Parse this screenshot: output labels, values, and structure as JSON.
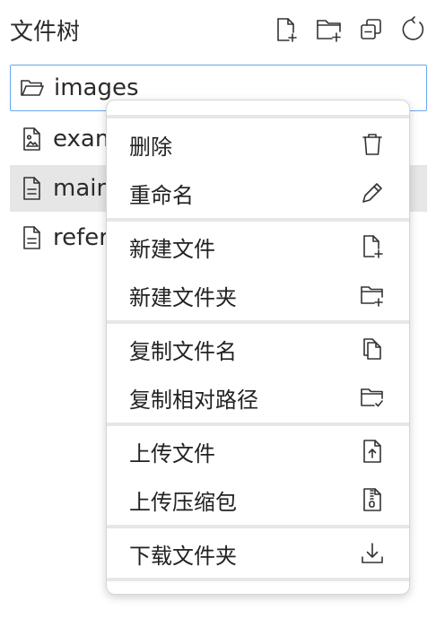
{
  "header": {
    "title": "文件树",
    "buttons": [
      {
        "icon": "new-file-icon"
      },
      {
        "icon": "new-folder-icon"
      },
      {
        "icon": "collapse-all-icon"
      },
      {
        "icon": "refresh-icon"
      }
    ]
  },
  "tree": {
    "items": [
      {
        "label": "images",
        "icon": "folder-open-icon",
        "state": "selected"
      },
      {
        "label": "exam",
        "icon": "image-file-icon",
        "state": "normal"
      },
      {
        "label": "main",
        "icon": "text-file-icon",
        "state": "active"
      },
      {
        "label": "refer",
        "icon": "text-file-icon",
        "state": "normal"
      }
    ]
  },
  "context_menu": {
    "items": [
      {
        "label": "删除",
        "icon": "trash-icon"
      },
      {
        "label": "重命名",
        "icon": "pencil-icon"
      },
      {
        "label": "新建文件",
        "icon": "new-file-icon"
      },
      {
        "label": "新建文件夹",
        "icon": "new-folder-icon"
      },
      {
        "label": "复制文件名",
        "icon": "copy-icon"
      },
      {
        "label": "复制相对路径",
        "icon": "folder-check-icon"
      },
      {
        "label": "上传文件",
        "icon": "upload-file-icon"
      },
      {
        "label": "上传压缩包",
        "icon": "zip-file-icon"
      },
      {
        "label": "下载文件夹",
        "icon": "download-icon"
      }
    ]
  },
  "colors": {
    "selected_border": "#6aa7f0",
    "active_row_bg": "#e6e6e6",
    "separator": "#e7e7e7"
  }
}
